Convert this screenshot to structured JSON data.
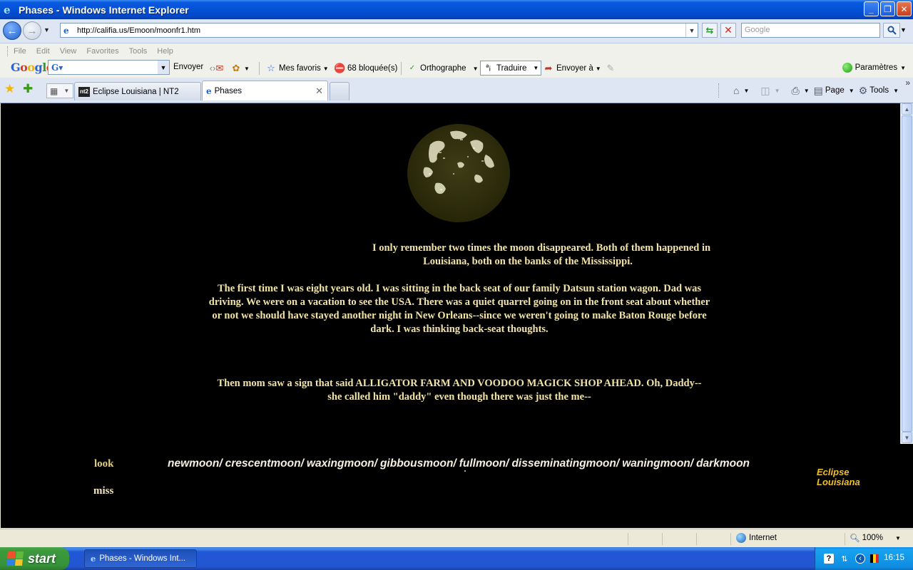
{
  "window": {
    "title": "Phases - Windows Internet Explorer"
  },
  "address_bar": {
    "url": "http://califia.us/Emoon/moonfr1.htm",
    "search_placeholder": "Google"
  },
  "menu": {
    "items": [
      "File",
      "Edit",
      "View",
      "Favorites",
      "Tools",
      "Help"
    ]
  },
  "google_toolbar": {
    "logo": "Google",
    "search_value": "",
    "send_label": "Envoyer",
    "favorites_label": "Mes favoris",
    "blocked_label": "68 bloquée(s)",
    "spell_label": "Orthographe",
    "translate_label": "Traduire",
    "sendto_label": "Envoyer à",
    "settings_label": "Paramètres"
  },
  "tabs": [
    {
      "label": "Eclipse Louisiana | NT2",
      "favicon": "nt2",
      "active": false
    },
    {
      "label": "Phases",
      "active": true
    }
  ],
  "command_bar": {
    "page_label": "Page",
    "tools_label": "Tools"
  },
  "content": {
    "para1": "I only remember two times the moon disappeared. Both of them happened in Louisiana, both on the banks of the Mississippi.",
    "para2": "The first time I was eight years old.  I was sitting in the back seat of our family Datsun station wagon.  Dad was driving.  We were on a vacation to see the USA.  There was a quiet quarrel going on in the front seat about whether or not we should have stayed another night in New Orleans--since we weren't going to make Baton Rouge before dark.  I was thinking back-seat thoughts.",
    "para3": "Then mom saw a sign that said ALLIGATOR FARM AND VOODOO MAGICK SHOP AHEAD.  Oh, Daddy--she called him \"daddy\" even though there was just the me--",
    "look_label": "look",
    "miss_label": "miss",
    "phases": [
      "newmoon/",
      "crescentmoon/",
      "waxingmoon/",
      "gibbousmoon/",
      "fullmoon/",
      "disseminatingmoon/",
      "waningmoon/",
      "darkmoon"
    ],
    "eclipse_link_line1": "Eclipse",
    "eclipse_link_line2": "Louisiana"
  },
  "status_bar": {
    "zone": "Internet",
    "zoom": "100%"
  },
  "taskbar": {
    "start_label": "start",
    "task_label": "Phases - Windows Int...",
    "clock": "16:15"
  },
  "colors": {
    "story_text": "#f2e4a6",
    "look_link": "#e0cf86",
    "eclipse_link": "#f0c02a",
    "page_background": "#000000"
  }
}
